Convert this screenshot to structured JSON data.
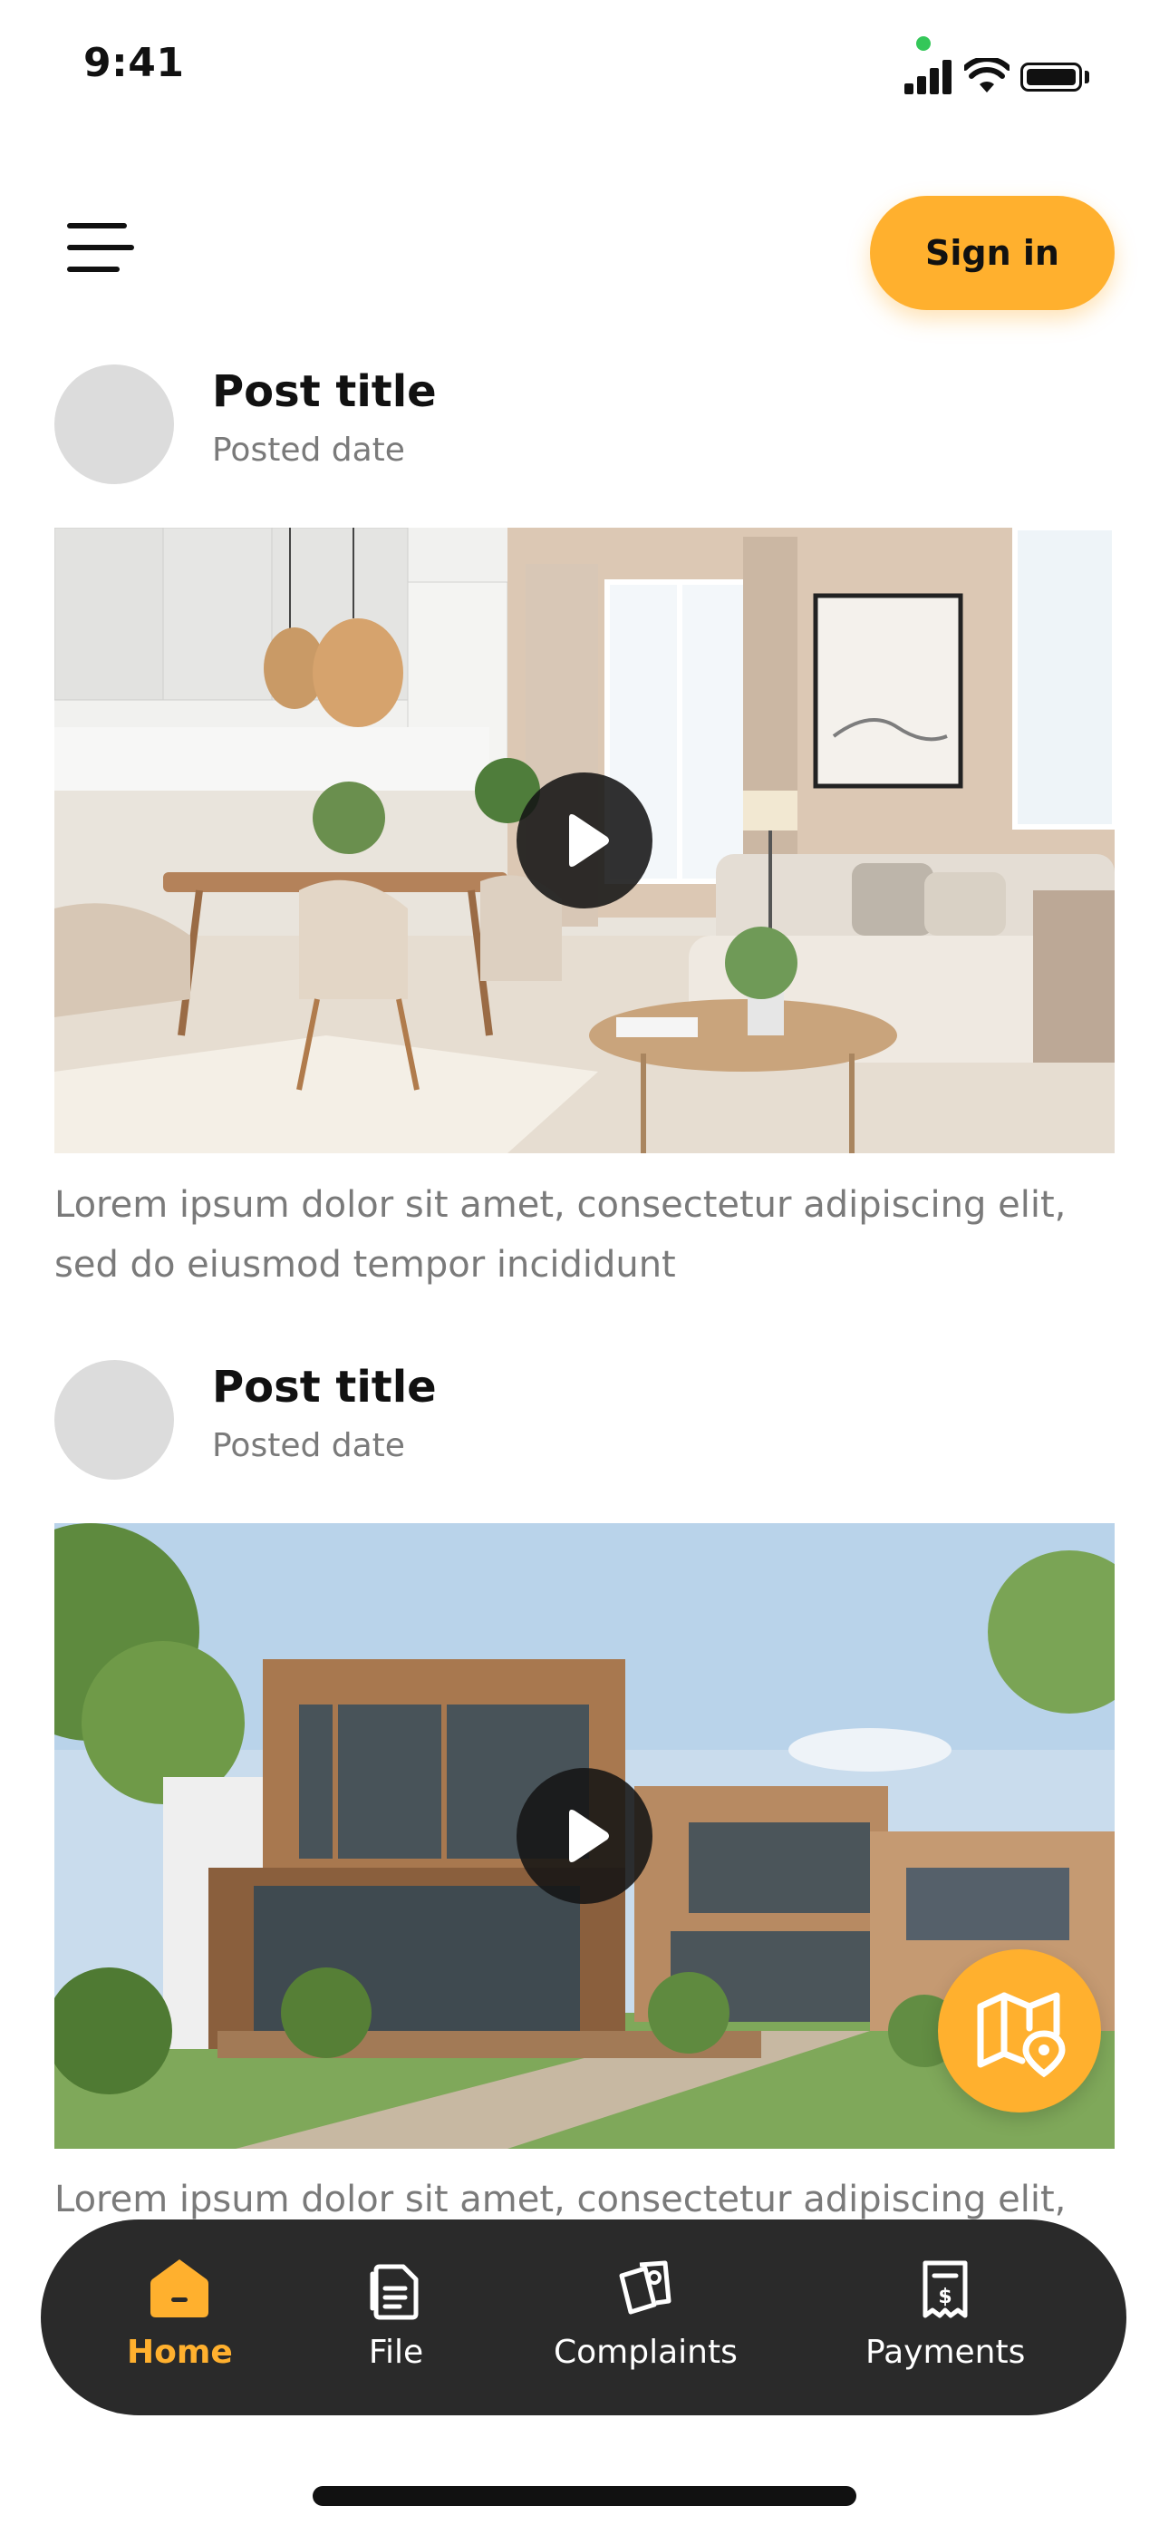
{
  "status_bar": {
    "time": "9:41"
  },
  "header": {
    "sign_in_label": "Sign in"
  },
  "posts": [
    {
      "title": "Post title",
      "date": "Posted date",
      "text_line1": "Lorem ipsum dolor sit amet, consectetur adipiscing elit,",
      "text_line2": "sed do eiusmod tempor incididunt"
    },
    {
      "title": "Post title",
      "date": "Posted date",
      "text_line1": "Lorem ipsum dolor sit amet, consectetur adipiscing elit,",
      "text_line2": ""
    }
  ],
  "bottom_nav": {
    "items": [
      {
        "label": "Home",
        "icon": "home-icon",
        "active": true
      },
      {
        "label": "File",
        "icon": "file-icon",
        "active": false
      },
      {
        "label": "Complaints",
        "icon": "complaints-icon",
        "active": false
      },
      {
        "label": "Payments",
        "icon": "payments-icon",
        "active": false
      }
    ]
  },
  "colors": {
    "accent": "#ffb02e",
    "nav_bg": "#2a2a2a",
    "muted_text": "#7a7a7a",
    "avatar": "#dcdcdc"
  }
}
